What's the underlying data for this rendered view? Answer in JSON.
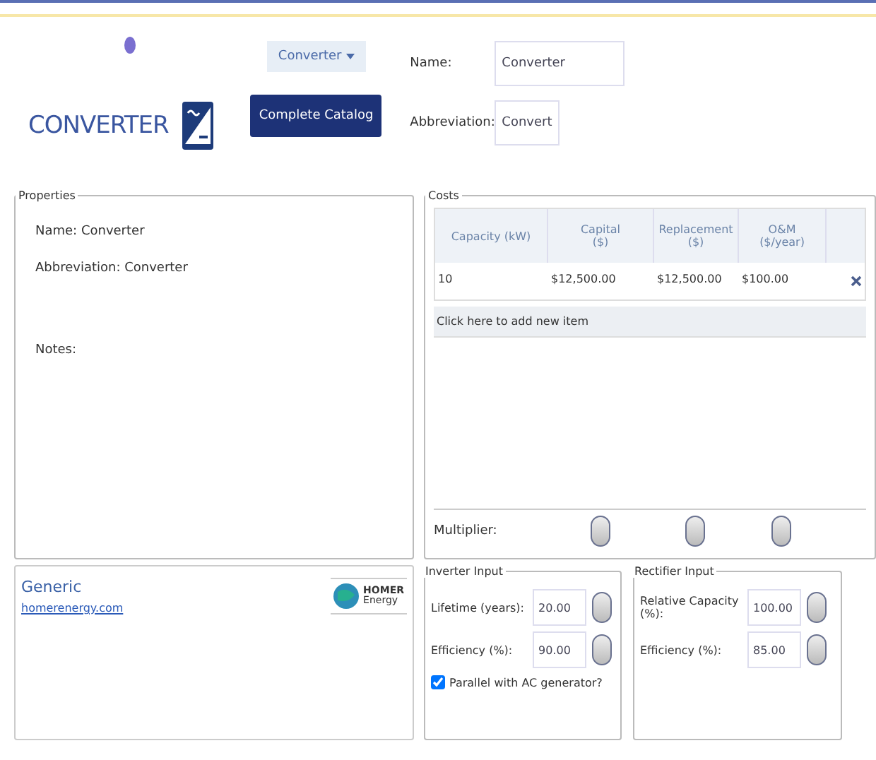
{
  "header": {
    "title": "CONVERTER",
    "component_dropdown": "Converter",
    "catalog_button": "Complete Catalog",
    "fields": [
      {
        "label": "Name:",
        "value": "Converter"
      },
      {
        "label": "Abbreviation:",
        "value": "Convert"
      }
    ]
  },
  "properties": {
    "legend": "Properties",
    "lines": [
      "Name: Converter",
      "Abbreviation: Converter",
      "Notes:"
    ]
  },
  "costs": {
    "legend": "Costs",
    "columns": [
      {
        "lines": [
          "Capacity (kW)"
        ]
      },
      {
        "lines": [
          "Capital",
          "($)"
        ]
      },
      {
        "lines": [
          "Replacement",
          "($)"
        ]
      },
      {
        "lines": [
          "O&M",
          "($/year)"
        ]
      }
    ],
    "rows": [
      [
        "10",
        "$12,500.00",
        "$12,500.00",
        "$100.00"
      ]
    ],
    "add_row": "Click here to add new item",
    "multiplier_label": "Multiplier:"
  },
  "manufacturer": {
    "name": "Generic",
    "link": "homerenergy.com",
    "logo_text": [
      "HOMER",
      "Energy"
    ]
  },
  "inverter": {
    "legend": "Inverter Input",
    "fields": [
      {
        "label": "Lifetime (years):",
        "value": "20.00"
      },
      {
        "label": "Efficiency (%):",
        "value": "90.00"
      }
    ],
    "checkbox": {
      "label": "Parallel with AC generator?",
      "checked": true
    }
  },
  "rectifier": {
    "legend": "Rectifier Input",
    "fields": [
      {
        "label": "Relative Capacity (%):",
        "value": "100.00"
      },
      {
        "label": "Efficiency (%):",
        "value": "85.00"
      }
    ]
  }
}
